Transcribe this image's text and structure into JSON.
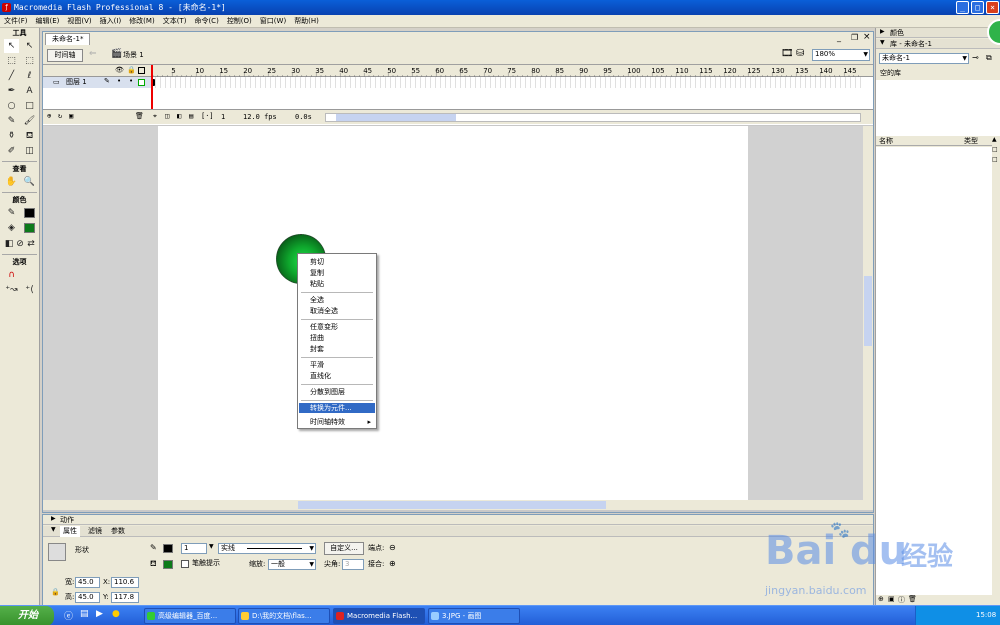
{
  "window": {
    "title": "Macromedia Flash Professional 8 - [未命名-1*]"
  },
  "menu": [
    "文件(F)",
    "编辑(E)",
    "视图(V)",
    "插入(I)",
    "修改(M)",
    "文本(T)",
    "命令(C)",
    "控制(O)",
    "窗口(W)",
    "帮助(H)"
  ],
  "tools": {
    "title": "工具",
    "view_title": "查看",
    "colors_title": "颜色",
    "options_title": "选项",
    "icons": [
      "arrow-icon",
      "subselect-icon",
      "free-transform-icon",
      "fill-transform-icon",
      "line-icon",
      "lasso-icon",
      "pen-icon",
      "text-icon",
      "oval-icon",
      "rectangle-icon",
      "pencil-icon",
      "brush-icon",
      "ink-bottle-icon",
      "paint-bucket-icon",
      "eyedropper-icon",
      "eraser-icon"
    ],
    "glyphs": [
      "↖",
      "↖",
      "⬚",
      "⬚",
      "╱",
      "ℓ",
      "✒",
      "A",
      "○",
      "□",
      "✎",
      "🖌",
      "⚱",
      "⛾",
      "✐",
      "◫"
    ],
    "stroke_color": "#000000",
    "fill_color": "#0d7a1a"
  },
  "document": {
    "tab_label": "未命名-1*",
    "timeline_button": "时间轴",
    "scene_label": "场景 1",
    "zoom": "180%"
  },
  "timeline": {
    "frame_numbers": [
      "5",
      "10",
      "15",
      "20",
      "25",
      "30",
      "35",
      "40",
      "45",
      "50",
      "55",
      "60",
      "65",
      "70",
      "75",
      "80",
      "85",
      "90",
      "95",
      "100",
      "105",
      "110",
      "115",
      "120",
      "125",
      "130",
      "135",
      "140",
      "145"
    ],
    "layer_name": "图层 1",
    "current_frame": "1",
    "frame_rate": "12.0 fps",
    "elapsed": "0.0s"
  },
  "context_menu": {
    "items": [
      {
        "label": "剪切",
        "highlighted": false,
        "submenu": false
      },
      {
        "label": "复制",
        "highlighted": false,
        "submenu": false
      },
      {
        "label": "粘贴",
        "highlighted": false,
        "submenu": false
      },
      {
        "label": "全选",
        "highlighted": false,
        "submenu": false
      },
      {
        "label": "取消全选",
        "highlighted": false,
        "submenu": false
      },
      {
        "label": "任意变形",
        "highlighted": false,
        "submenu": false
      },
      {
        "label": "扭曲",
        "highlighted": false,
        "submenu": false
      },
      {
        "label": "封套",
        "highlighted": false,
        "submenu": false
      },
      {
        "label": "平滑",
        "highlighted": false,
        "submenu": false
      },
      {
        "label": "直线化",
        "highlighted": false,
        "submenu": false
      },
      {
        "label": "分散到图层",
        "highlighted": false,
        "submenu": false
      },
      {
        "label": "转换为元件...",
        "highlighted": true,
        "submenu": false
      },
      {
        "label": "时间轴特效",
        "highlighted": false,
        "submenu": true
      }
    ]
  },
  "properties": {
    "actions_label": "动作",
    "tabs": [
      "属性",
      "滤镜",
      "参数"
    ],
    "shape_label": "形状",
    "stroke_height": "1",
    "stroke_style": "实线",
    "custom_button": "自定义...",
    "cap_label": "端点:",
    "hinting_label": "笔触提示",
    "scale_label": "缩放:",
    "scale_value": "一般",
    "miter_label": "尖角:",
    "miter_value": "3",
    "join_label": "接合:",
    "width_label": "宽:",
    "width_value": "45.0",
    "height_label": "高:",
    "height_value": "45.0",
    "x_label": "X:",
    "x_value": "110.6",
    "y_label": "Y:",
    "y_value": "117.8"
  },
  "right_panel": {
    "color_title": "颜色",
    "library_title": "库 - 未命名-1",
    "library_select": "未命名-1",
    "empty_library": "空的库",
    "col_name": "名称",
    "col_type": "类型"
  },
  "taskbar": {
    "start_label": "开始",
    "tasks": [
      "高级编辑器_百度...",
      "D:\\我的文档\\flas...",
      "Macromedia Flash...",
      "3.JPG - 画图"
    ],
    "clock": "15:08"
  },
  "watermark": {
    "brand": "Bai",
    "brand2": "du",
    "cn": "经验",
    "url": "jingyan.baidu.com"
  }
}
